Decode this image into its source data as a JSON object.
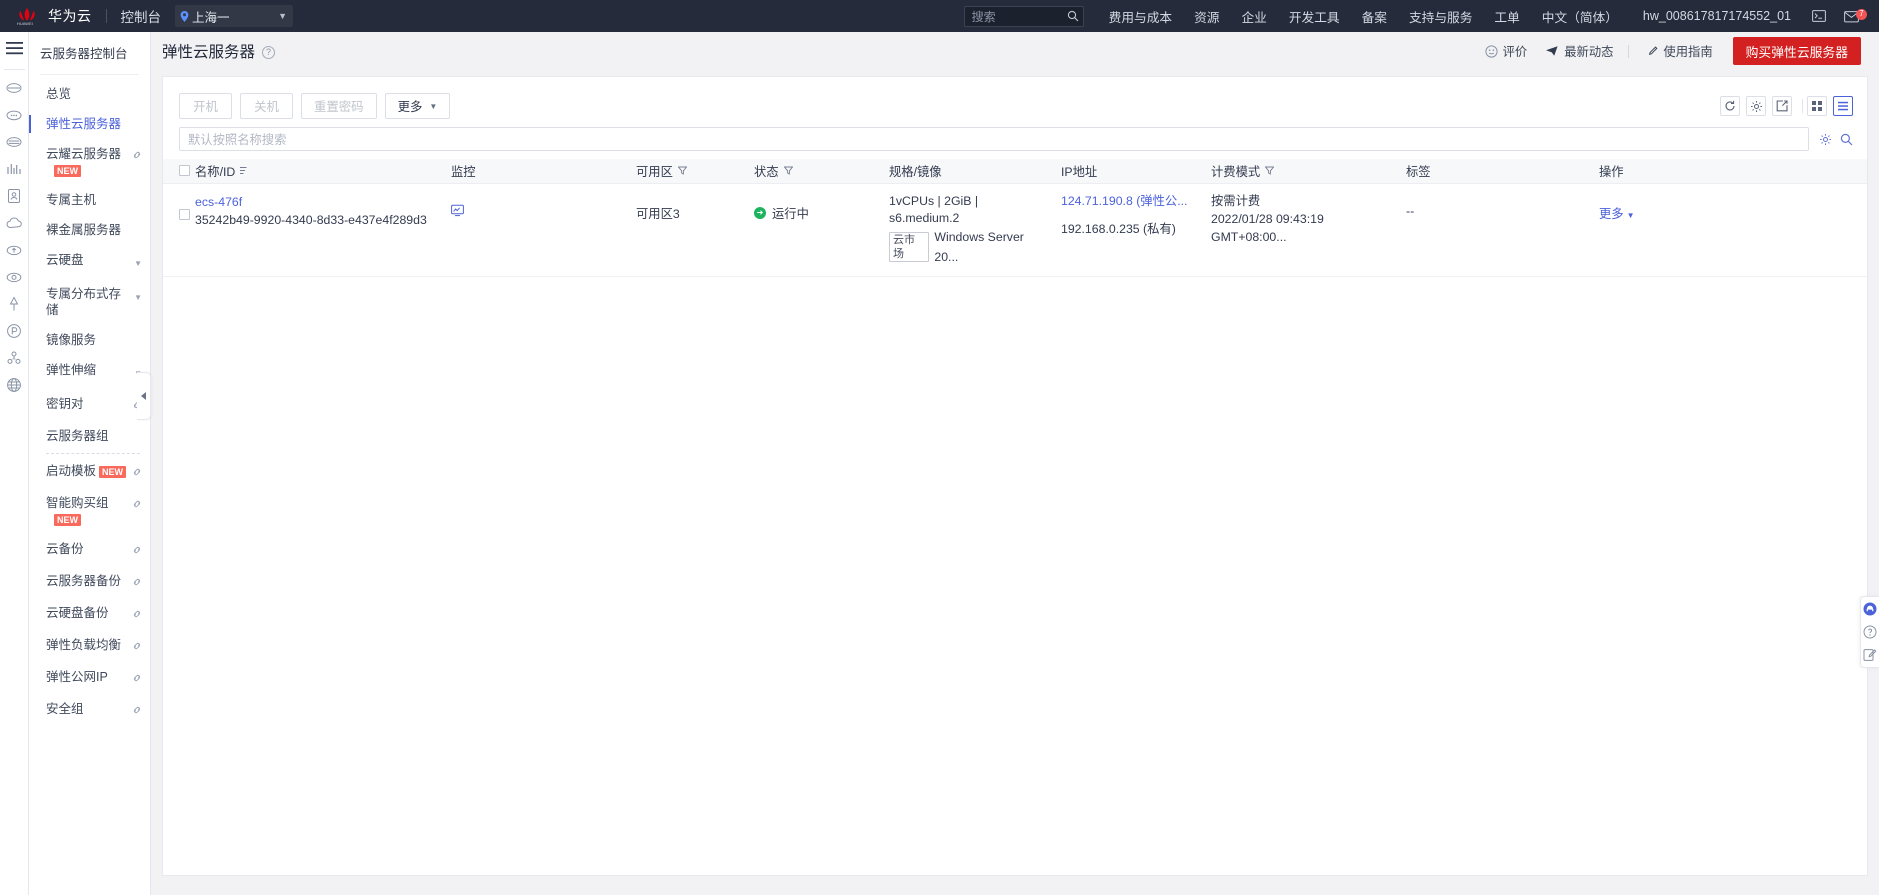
{
  "topnav": {
    "brand": "华为云",
    "console": "控制台",
    "region": "上海一",
    "search_placeholder": "搜索",
    "items": [
      {
        "label": "费用与成本"
      },
      {
        "label": "资源"
      },
      {
        "label": "企业"
      },
      {
        "label": "开发工具"
      },
      {
        "label": "备案"
      },
      {
        "label": "支持与服务"
      },
      {
        "label": "工单"
      },
      {
        "label": "中文（简体）"
      }
    ],
    "user": "hw_008617817174552_01",
    "message_badge": "7"
  },
  "rail": {
    "icons": [
      "menu-burger-icon",
      "cloud-server-icon",
      "cloud-dots-icon",
      "cloud-stack-icon",
      "analytics-icon",
      "document-icon",
      "cloud-outline-icon",
      "cloud-up-icon",
      "cloud-sync-icon",
      "anchor-icon",
      "pin-circle-icon",
      "network-icon",
      "globe-icon"
    ]
  },
  "sidebar": {
    "title": "云服务器控制台",
    "items": [
      {
        "label": "总览",
        "active": false,
        "link": false,
        "caret": false,
        "new": false
      },
      {
        "label": "弹性云服务器",
        "active": true,
        "link": false,
        "caret": false,
        "new": false
      },
      {
        "label": "云耀云服务器",
        "active": false,
        "link": true,
        "caret": false,
        "new": true,
        "new_below": true
      },
      {
        "label": "专属主机",
        "active": false,
        "link": false,
        "caret": false,
        "new": false
      },
      {
        "label": "裸金属服务器",
        "active": false,
        "link": false,
        "caret": false,
        "new": false
      },
      {
        "label": "云硬盘",
        "active": false,
        "link": false,
        "caret": true,
        "new": false
      },
      {
        "label": "专属分布式存储",
        "active": false,
        "link": false,
        "caret": true,
        "new": false
      },
      {
        "label": "镜像服务",
        "active": false,
        "link": false,
        "caret": false,
        "new": false
      },
      {
        "label": "弹性伸缩",
        "active": false,
        "link": false,
        "caret": true,
        "new": false
      },
      {
        "label": "密钥对",
        "active": false,
        "link": true,
        "caret": false,
        "new": false
      },
      {
        "label": "云服务器组",
        "active": false,
        "link": false,
        "caret": false,
        "new": false,
        "divider_after": true
      },
      {
        "label": "启动模板",
        "active": false,
        "link": true,
        "caret": false,
        "new": true,
        "new_below": false
      },
      {
        "label": "智能购买组",
        "active": false,
        "link": true,
        "caret": false,
        "new": true,
        "new_below": true
      },
      {
        "label": "云备份",
        "active": false,
        "link": true,
        "caret": false,
        "new": false
      },
      {
        "label": "云服务器备份",
        "active": false,
        "link": true,
        "caret": false,
        "new": false
      },
      {
        "label": "云硬盘备份",
        "active": false,
        "link": true,
        "caret": false,
        "new": false
      },
      {
        "label": "弹性负载均衡",
        "active": false,
        "link": true,
        "caret": false,
        "new": false
      },
      {
        "label": "弹性公网IP",
        "active": false,
        "link": true,
        "caret": false,
        "new": false
      },
      {
        "label": "安全组",
        "active": false,
        "link": true,
        "caret": false,
        "new": false
      }
    ],
    "new_badge_text": "NEW"
  },
  "header": {
    "title": "弹性云服务器",
    "help": "?",
    "actions": [
      {
        "label": "评价",
        "icon": "smiley-icon"
      },
      {
        "label": "最新动态",
        "icon": "megaphone-icon"
      },
      {
        "label": "使用指南",
        "icon": "guide-book-icon"
      }
    ],
    "buy_button": "购买弹性云服务器"
  },
  "toolbar": {
    "buttons": [
      {
        "label": "开机",
        "enabled": false
      },
      {
        "label": "关机",
        "enabled": false
      },
      {
        "label": "重置密码",
        "enabled": false
      },
      {
        "label": "更多",
        "enabled": true,
        "dropdown": true
      }
    ],
    "icons": [
      {
        "name": "refresh-icon",
        "selected": false
      },
      {
        "name": "settings-gear-icon",
        "selected": false
      },
      {
        "name": "export-icon",
        "selected": false
      },
      {
        "name": "grid-view-icon",
        "selected": false
      },
      {
        "name": "list-view-icon",
        "selected": true
      }
    ]
  },
  "search": {
    "placeholder": "默认按照名称搜索",
    "settings_icon": "filter-settings-icon",
    "search_icon": "search-icon"
  },
  "table": {
    "columns": [
      {
        "label": "名称/ID",
        "sort": true,
        "filter": false
      },
      {
        "label": "监控",
        "sort": false,
        "filter": false
      },
      {
        "label": "可用区",
        "sort": false,
        "filter": true
      },
      {
        "label": "状态",
        "sort": false,
        "filter": true
      },
      {
        "label": "规格/镜像",
        "sort": false,
        "filter": false
      },
      {
        "label": "IP地址",
        "sort": false,
        "filter": false
      },
      {
        "label": "计费模式",
        "sort": false,
        "filter": true
      },
      {
        "label": "标签",
        "sort": false,
        "filter": false
      },
      {
        "label": "操作",
        "sort": false,
        "filter": false
      }
    ],
    "rows": [
      {
        "name": "ecs-476f",
        "id": "35242b49-9920-4340-8d33-e437e4f289d3",
        "monitor_icon": "monitor-icon",
        "az": "可用区3",
        "status": "运行中",
        "status_color": "#20b35f",
        "spec": "1vCPUs | 2GiB | s6.medium.2",
        "image_tag": "云市场",
        "image": "Windows Server 20...",
        "ip_public": "124.71.190.8 (弹性公...",
        "ip_private": "192.168.0.235 (私有)",
        "billing_mode": "按需计费",
        "billing_time": "2022/01/28 09:43:19 GMT+08:00...",
        "tag": "--",
        "action": "更多"
      }
    ]
  },
  "dock": {
    "icons": [
      {
        "name": "support-headset-icon",
        "primary": true
      },
      {
        "name": "help-question-icon",
        "primary": false
      },
      {
        "name": "feedback-note-icon",
        "primary": false
      }
    ]
  }
}
